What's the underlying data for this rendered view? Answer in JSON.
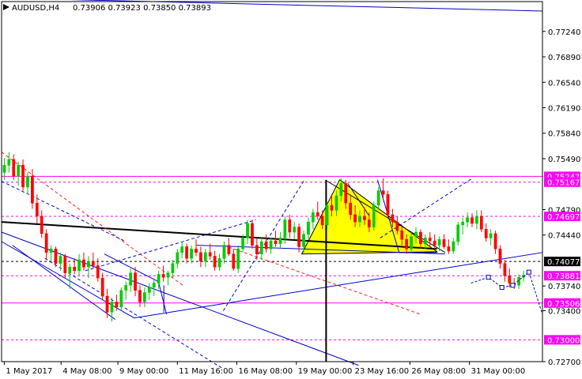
{
  "header": {
    "symbol": "AUDUSD,H4",
    "ohlc": "0.73906 0.73923 0.73850 0.73893"
  },
  "chart_data": {
    "type": "candlestick",
    "ylim": [
      0.727,
      0.7765
    ],
    "y_ticks": [
      "0.77240",
      "0.76890",
      "0.76540",
      "0.76190",
      "0.75840",
      "0.75490",
      "0.74790",
      "0.74440",
      "0.73740",
      "0.73400",
      "0.72700"
    ],
    "x_ticks": [
      "1 May 2017",
      "4 May 08:00",
      "9 May 00:00",
      "11 May 16:00",
      "16 May 08:00",
      "19 May 00:00",
      "23 May 16:00",
      "26 May 08:00",
      "31 May 00:00"
    ],
    "levels": [
      {
        "label": "0.75247",
        "value": 0.75247,
        "style": "solid",
        "color": "#ff00ff",
        "tag_bg": "#ff00ff",
        "tag_fg": "#ffffff"
      },
      {
        "label": "0.75167",
        "value": 0.75167,
        "style": "dashed",
        "color": "#ff00ff",
        "tag_bg": "#ff00ff",
        "tag_fg": "#ffffff"
      },
      {
        "label": "0.74697",
        "value": 0.74697,
        "style": "dashed",
        "color": "#ff00ff",
        "tag_bg": "#ff00ff",
        "tag_fg": "#ffffff"
      },
      {
        "label": "0.74077",
        "value": 0.74077,
        "style": "dashed",
        "color": "#000000",
        "tag_bg": "#000000",
        "tag_fg": "#ffffff"
      },
      {
        "label": "0.73881",
        "value": 0.73881,
        "style": "dashed",
        "color": "#ff00ff",
        "tag_bg": "#ff00ff",
        "tag_fg": "#ffffff"
      },
      {
        "label": "0.73506",
        "value": 0.73506,
        "style": "solid",
        "color": "#ff00ff",
        "tag_bg": "#ff00ff",
        "tag_fg": "#ffffff"
      },
      {
        "label": "0.73000",
        "value": 0.73,
        "style": "dashed",
        "color": "#ff00ff",
        "tag_bg": "#ff00ff",
        "tag_fg": "#ffffff"
      }
    ],
    "candles": [
      [
        0.753,
        0.755,
        0.752,
        0.754
      ],
      [
        0.754,
        0.7558,
        0.753,
        0.7548
      ],
      [
        0.7548,
        0.7555,
        0.752,
        0.7525
      ],
      [
        0.7525,
        0.7545,
        0.7512,
        0.754
      ],
      [
        0.754,
        0.7548,
        0.7505,
        0.751
      ],
      [
        0.751,
        0.753,
        0.75,
        0.7525
      ],
      [
        0.7525,
        0.7535,
        0.748,
        0.7488
      ],
      [
        0.7488,
        0.75,
        0.746,
        0.747
      ],
      [
        0.747,
        0.7478,
        0.744,
        0.7446
      ],
      [
        0.7446,
        0.7452,
        0.741,
        0.742
      ],
      [
        0.742,
        0.743,
        0.7408,
        0.7425
      ],
      [
        0.7425,
        0.7428,
        0.74,
        0.7405
      ],
      [
        0.7405,
        0.742,
        0.7395,
        0.7415
      ],
      [
        0.7415,
        0.7418,
        0.7385,
        0.7392
      ],
      [
        0.7392,
        0.7405,
        0.737,
        0.74
      ],
      [
        0.74,
        0.7412,
        0.739,
        0.7395
      ],
      [
        0.7395,
        0.7418,
        0.7388,
        0.741
      ],
      [
        0.741,
        0.742,
        0.7395,
        0.74
      ],
      [
        0.74,
        0.7415,
        0.7385,
        0.7408
      ],
      [
        0.7408,
        0.742,
        0.7398,
        0.7402
      ],
      [
        0.7402,
        0.7412,
        0.738,
        0.7385
      ],
      [
        0.7385,
        0.7392,
        0.7355,
        0.736
      ],
      [
        0.736,
        0.737,
        0.733,
        0.7338
      ],
      [
        0.7338,
        0.7358,
        0.7325,
        0.7352
      ],
      [
        0.7352,
        0.7362,
        0.734,
        0.7345
      ],
      [
        0.7345,
        0.7372,
        0.734,
        0.7368
      ],
      [
        0.7368,
        0.738,
        0.7355,
        0.7375
      ],
      [
        0.7375,
        0.7398,
        0.7366,
        0.7392
      ],
      [
        0.7392,
        0.74,
        0.736,
        0.7368
      ],
      [
        0.7368,
        0.7375,
        0.7345,
        0.7352
      ],
      [
        0.7352,
        0.7372,
        0.7345,
        0.7365
      ],
      [
        0.7365,
        0.7378,
        0.7355,
        0.7372
      ],
      [
        0.7372,
        0.7382,
        0.736,
        0.7378
      ],
      [
        0.7378,
        0.7395,
        0.737,
        0.739
      ],
      [
        0.739,
        0.7402,
        0.738,
        0.7386
      ],
      [
        0.7386,
        0.7395,
        0.7375,
        0.7392
      ],
      [
        0.7392,
        0.741,
        0.7385,
        0.7405
      ],
      [
        0.7405,
        0.7425,
        0.7398,
        0.742
      ],
      [
        0.742,
        0.7435,
        0.7412,
        0.7428
      ],
      [
        0.7428,
        0.7432,
        0.7405,
        0.7412
      ],
      [
        0.7412,
        0.743,
        0.7405,
        0.7425
      ],
      [
        0.7425,
        0.7438,
        0.7415,
        0.742
      ],
      [
        0.742,
        0.7428,
        0.74,
        0.7408
      ],
      [
        0.7408,
        0.7425,
        0.74,
        0.742
      ],
      [
        0.742,
        0.7432,
        0.741,
        0.7415
      ],
      [
        0.7415,
        0.7422,
        0.7395,
        0.74
      ],
      [
        0.74,
        0.7418,
        0.7395,
        0.7412
      ],
      [
        0.7412,
        0.7435,
        0.7405,
        0.743
      ],
      [
        0.743,
        0.744,
        0.7415,
        0.7418
      ],
      [
        0.7418,
        0.7425,
        0.7395,
        0.7398
      ],
      [
        0.7398,
        0.743,
        0.7392,
        0.7425
      ],
      [
        0.7425,
        0.7445,
        0.742,
        0.744
      ],
      [
        0.744,
        0.7465,
        0.7432,
        0.746
      ],
      [
        0.746,
        0.7465,
        0.7425,
        0.743
      ],
      [
        0.743,
        0.744,
        0.741,
        0.7418
      ],
      [
        0.7418,
        0.744,
        0.741,
        0.7435
      ],
      [
        0.7435,
        0.7445,
        0.742,
        0.7425
      ],
      [
        0.7425,
        0.744,
        0.7418,
        0.7436
      ],
      [
        0.7436,
        0.745,
        0.7428,
        0.7432
      ],
      [
        0.7432,
        0.7448,
        0.7425,
        0.744
      ],
      [
        0.744,
        0.747,
        0.7432,
        0.7465
      ],
      [
        0.7465,
        0.7472,
        0.744,
        0.7448
      ],
      [
        0.7448,
        0.7462,
        0.7438,
        0.7455
      ],
      [
        0.7455,
        0.746,
        0.742,
        0.7428
      ],
      [
        0.7428,
        0.745,
        0.742,
        0.7445
      ],
      [
        0.7445,
        0.7468,
        0.7438,
        0.7462
      ],
      [
        0.7462,
        0.748,
        0.7452,
        0.7475
      ],
      [
        0.7475,
        0.749,
        0.7465,
        0.747
      ],
      [
        0.747,
        0.7478,
        0.7452,
        0.7458
      ],
      [
        0.7458,
        0.749,
        0.7452,
        0.7485
      ],
      [
        0.7485,
        0.75,
        0.747,
        0.7478
      ],
      [
        0.7478,
        0.7505,
        0.747,
        0.7498
      ],
      [
        0.7498,
        0.7522,
        0.749,
        0.7515
      ],
      [
        0.7515,
        0.752,
        0.748,
        0.7488
      ],
      [
        0.7488,
        0.75,
        0.7465,
        0.7472
      ],
      [
        0.7472,
        0.7485,
        0.7455,
        0.7462
      ],
      [
        0.7462,
        0.7478,
        0.7455,
        0.747
      ],
      [
        0.747,
        0.7482,
        0.7458,
        0.7465
      ],
      [
        0.7465,
        0.7475,
        0.7448,
        0.7455
      ],
      [
        0.7455,
        0.749,
        0.745,
        0.7485
      ],
      [
        0.7485,
        0.751,
        0.7478,
        0.7505
      ],
      [
        0.7505,
        0.7522,
        0.7492,
        0.75
      ],
      [
        0.75,
        0.7505,
        0.7468,
        0.7472
      ],
      [
        0.7472,
        0.748,
        0.7455,
        0.7462
      ],
      [
        0.7462,
        0.747,
        0.7445,
        0.745
      ],
      [
        0.745,
        0.7458,
        0.743,
        0.7438
      ],
      [
        0.7438,
        0.7445,
        0.7418,
        0.7425
      ],
      [
        0.7425,
        0.7448,
        0.742,
        0.7442
      ],
      [
        0.7442,
        0.7455,
        0.7432,
        0.7448
      ],
      [
        0.7448,
        0.7452,
        0.7425,
        0.7432
      ],
      [
        0.7432,
        0.7445,
        0.7425,
        0.744
      ],
      [
        0.744,
        0.7448,
        0.7428,
        0.7436
      ],
      [
        0.7436,
        0.7445,
        0.7425,
        0.743
      ],
      [
        0.743,
        0.7442,
        0.7422,
        0.7438
      ],
      [
        0.7438,
        0.7445,
        0.7425,
        0.7428
      ],
      [
        0.7428,
        0.7438,
        0.7418,
        0.7422
      ],
      [
        0.7422,
        0.744,
        0.7418,
        0.7435
      ],
      [
        0.7435,
        0.7462,
        0.743,
        0.7458
      ],
      [
        0.7458,
        0.7468,
        0.7445,
        0.7462
      ],
      [
        0.7462,
        0.7475,
        0.7455,
        0.7468
      ],
      [
        0.7468,
        0.7474,
        0.7455,
        0.746
      ],
      [
        0.746,
        0.7478,
        0.7452,
        0.747
      ],
      [
        0.747,
        0.7478,
        0.7448,
        0.7452
      ],
      [
        0.7452,
        0.746,
        0.7435,
        0.744
      ],
      [
        0.744,
        0.7452,
        0.743,
        0.7446
      ],
      [
        0.7446,
        0.745,
        0.7418,
        0.7425
      ],
      [
        0.7425,
        0.743,
        0.7398,
        0.7405
      ],
      [
        0.7405,
        0.741,
        0.738,
        0.7388
      ],
      [
        0.7388,
        0.7398,
        0.7372,
        0.7378
      ],
      [
        0.7378,
        0.7385,
        0.737,
        0.7375
      ],
      [
        0.7375,
        0.739,
        0.737,
        0.7386
      ],
      [
        0.7386,
        0.7395,
        0.738,
        0.7389
      ]
    ],
    "trendlines": [
      {
        "x1": 0.0,
        "y1": 0.7462,
        "x2": 0.805,
        "y2": 0.7425,
        "color": "#000000",
        "width": 2,
        "dash": "none"
      },
      {
        "x1": 0.0,
        "y1": 0.7558,
        "x2": 0.335,
        "y2": 0.7375,
        "color": "#ff2020",
        "width": 1,
        "dash": "4,3"
      },
      {
        "x1": 0.41,
        "y1": 0.743,
        "x2": 0.775,
        "y2": 0.7335,
        "color": "#ff2020",
        "width": 1,
        "dash": "4,3"
      },
      {
        "x1": 0.0,
        "y1": 0.7448,
        "x2": 0.66,
        "y2": 0.7265,
        "color": "#0000cc",
        "width": 1,
        "dash": "none"
      },
      {
        "x1": 0.0,
        "y1": 0.7435,
        "x2": 0.245,
        "y2": 0.733,
        "color": "#0000cc",
        "width": 1,
        "dash": "none"
      },
      {
        "x1": 0.245,
        "y1": 0.733,
        "x2": 1.0,
        "y2": 0.742,
        "color": "#0000cc",
        "width": 1,
        "dash": "none"
      },
      {
        "x1": 0.19,
        "y1": 0.7418,
        "x2": 0.29,
        "y2": 0.738,
        "color": "#0000cc",
        "width": 1,
        "dash": "none"
      },
      {
        "x1": 0.29,
        "y1": 0.738,
        "x2": 0.305,
        "y2": 0.7335,
        "color": "#0000cc",
        "width": 1,
        "dash": "none"
      },
      {
        "x1": 0.3,
        "y1": 0.7338,
        "x2": 0.3,
        "y2": 0.7375,
        "color": "#0000cc",
        "width": 1,
        "dash": "none"
      },
      {
        "x1": 0.0,
        "y1": 0.7518,
        "x2": 0.23,
        "y2": 0.7435,
        "color": "#0000cc",
        "width": 1,
        "dash": "4,3"
      },
      {
        "x1": 0.155,
        "y1": 0.7395,
        "x2": 0.47,
        "y2": 0.7465,
        "color": "#0000cc",
        "width": 1,
        "dash": "4,3"
      },
      {
        "x1": 0.41,
        "y1": 0.734,
        "x2": 0.56,
        "y2": 0.752,
        "color": "#0000cc",
        "width": 1,
        "dash": "4,3"
      },
      {
        "x1": 0.7,
        "y1": 0.744,
        "x2": 0.87,
        "y2": 0.7522,
        "color": "#0000cc",
        "width": 1,
        "dash": "4,3"
      },
      {
        "x1": 0.08,
        "y1": 0.7412,
        "x2": 0.41,
        "y2": 0.726,
        "color": "#0000cc",
        "width": 1,
        "dash": "4,3"
      },
      {
        "x1": 0.02,
        "y1": 0.743,
        "x2": 0.21,
        "y2": 0.7328,
        "color": "#0000cc",
        "width": 1,
        "dash": "none"
      },
      {
        "x1": 0.36,
        "y1": 0.743,
        "x2": 0.82,
        "y2": 0.7418,
        "color": "#0000cc",
        "width": 1,
        "dash": "none"
      },
      {
        "x1": 0.64,
        "y1": 0.7515,
        "x2": 0.68,
        "y2": 0.747,
        "color": "#0000cc",
        "width": 1,
        "dash": "none"
      },
      {
        "x1": 0.695,
        "y1": 0.752,
        "x2": 0.735,
        "y2": 0.742,
        "color": "#0000cc",
        "width": 1,
        "dash": "none"
      },
      {
        "x1": 0.735,
        "y1": 0.742,
        "x2": 0.805,
        "y2": 0.742,
        "color": "#0000cc",
        "width": 1,
        "dash": "none"
      },
      {
        "x1": 0.6,
        "y1": 0.7519,
        "x2": 0.82,
        "y2": 0.742,
        "color": "#000000",
        "width": 1,
        "dash": "none"
      },
      {
        "x1": 0.0,
        "y1": 0.777,
        "x2": 1.0,
        "y2": 0.7752,
        "color": "#0000cc",
        "width": 1,
        "dash": "none"
      }
    ],
    "triangle": [
      [
        0.555,
        0.7418
      ],
      [
        0.625,
        0.752
      ],
      [
        0.805,
        0.7421
      ]
    ],
    "vline_x": 0.6,
    "forecast": [
      [
        0.868,
        0.7378
      ],
      [
        0.9,
        0.7386
      ],
      [
        0.925,
        0.7372
      ],
      [
        0.945,
        0.7375
      ],
      [
        0.975,
        0.7393
      ],
      [
        1.0,
        0.7335
      ]
    ]
  }
}
